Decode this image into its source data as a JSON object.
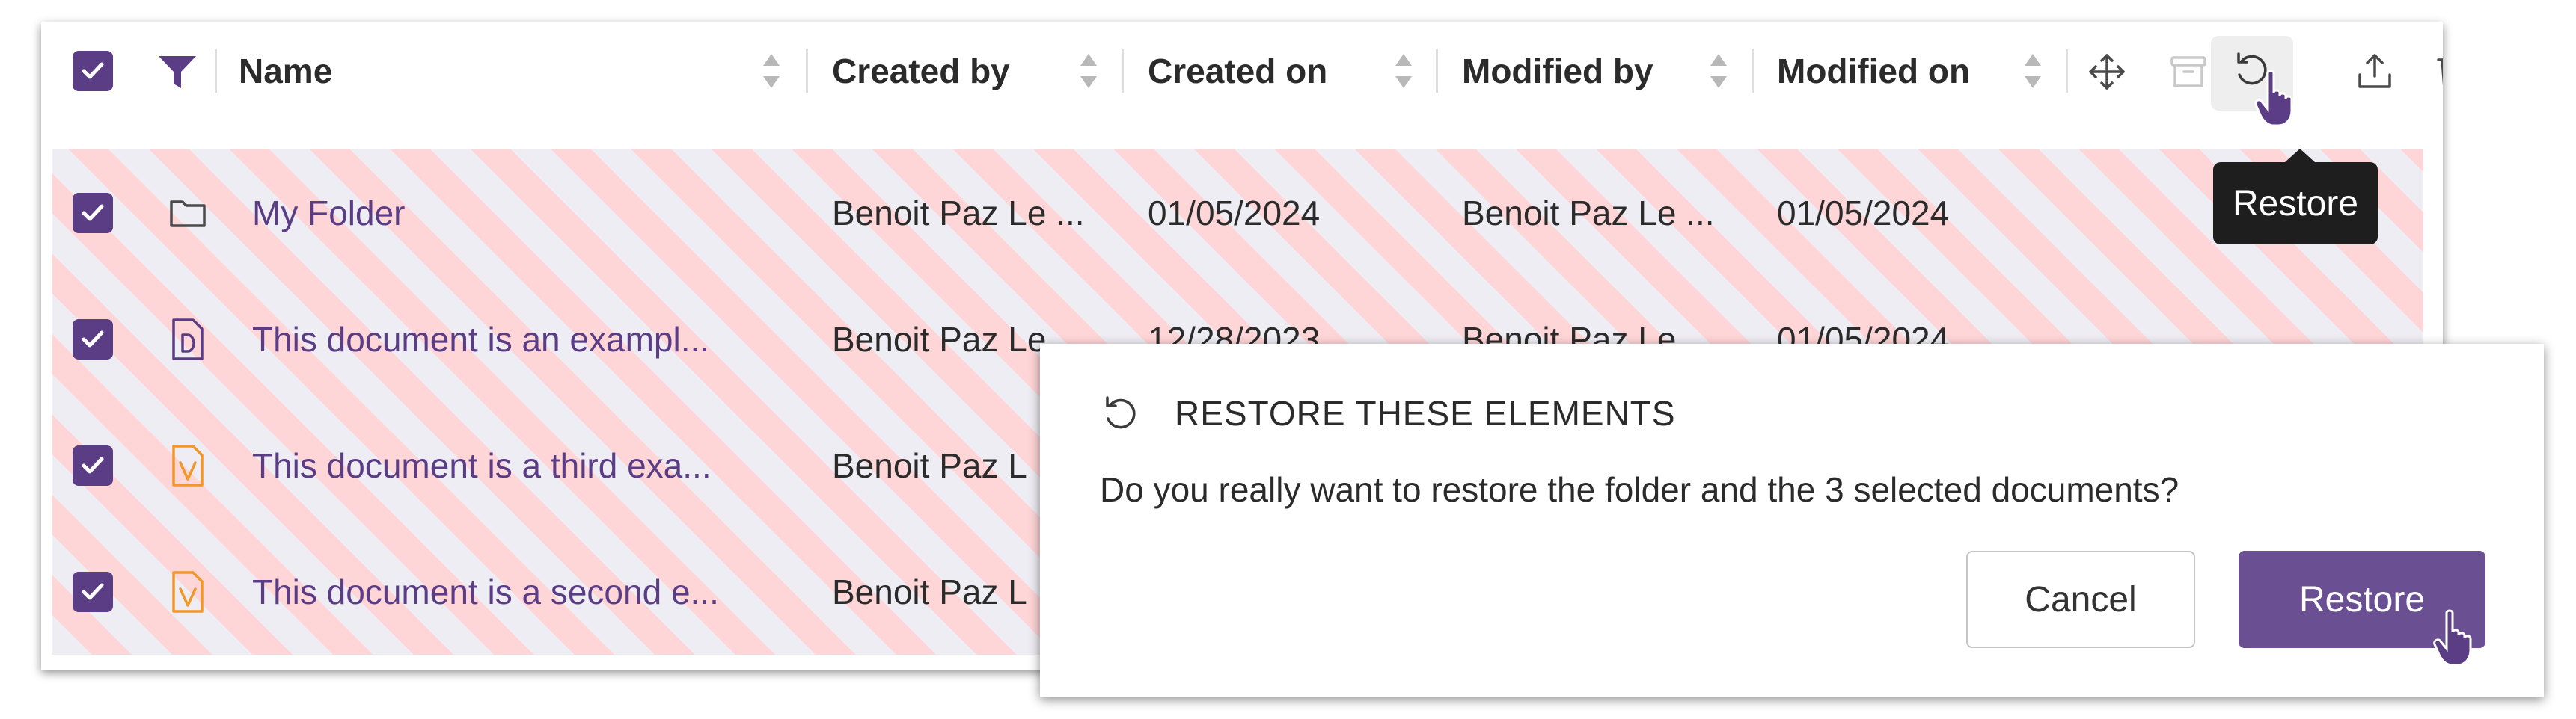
{
  "table": {
    "columns": {
      "name": "Name",
      "created_by": "Created by",
      "created_on": "Created on",
      "modified_by": "Modified by",
      "modified_on": "Modified on"
    },
    "rows": [
      {
        "icon": "folder-icon",
        "name": "My Folder",
        "created_by": "Benoit Paz Le ...",
        "created_on": "01/05/2024",
        "modified_by": "Benoit Paz Le ...",
        "modified_on": "01/05/2024",
        "checked": true
      },
      {
        "icon": "document-d-icon",
        "name": "This document is an exampl...",
        "created_by": "Benoit Paz Le",
        "created_on": "12/28/2023",
        "modified_by": "Benoit Paz Le",
        "modified_on": "01/05/2024",
        "checked": true
      },
      {
        "icon": "document-v-icon",
        "name": "This document is a third exa...",
        "created_by": "Benoit Paz L",
        "checked": true
      },
      {
        "icon": "document-v-icon",
        "name": "This document is a second e...",
        "created_by": "Benoit Paz L",
        "checked": true
      }
    ]
  },
  "toolbar": {
    "icons": [
      "move-icon",
      "archive-icon",
      "restore-icon",
      "export-icon",
      "trash-icon"
    ],
    "tooltip": "Restore"
  },
  "dialog": {
    "title": "RESTORE THESE ELEMENTS",
    "message": "Do you really want to restore the folder and the 3 selected documents?",
    "cancel_label": "Cancel",
    "restore_label": "Restore"
  },
  "colors": {
    "accent": "#5b3d86",
    "button": "#6a4f92",
    "stripe_pink": "#ffd6d8",
    "stripe_grey": "#eeedf3",
    "doc_orange": "#f0962a"
  }
}
